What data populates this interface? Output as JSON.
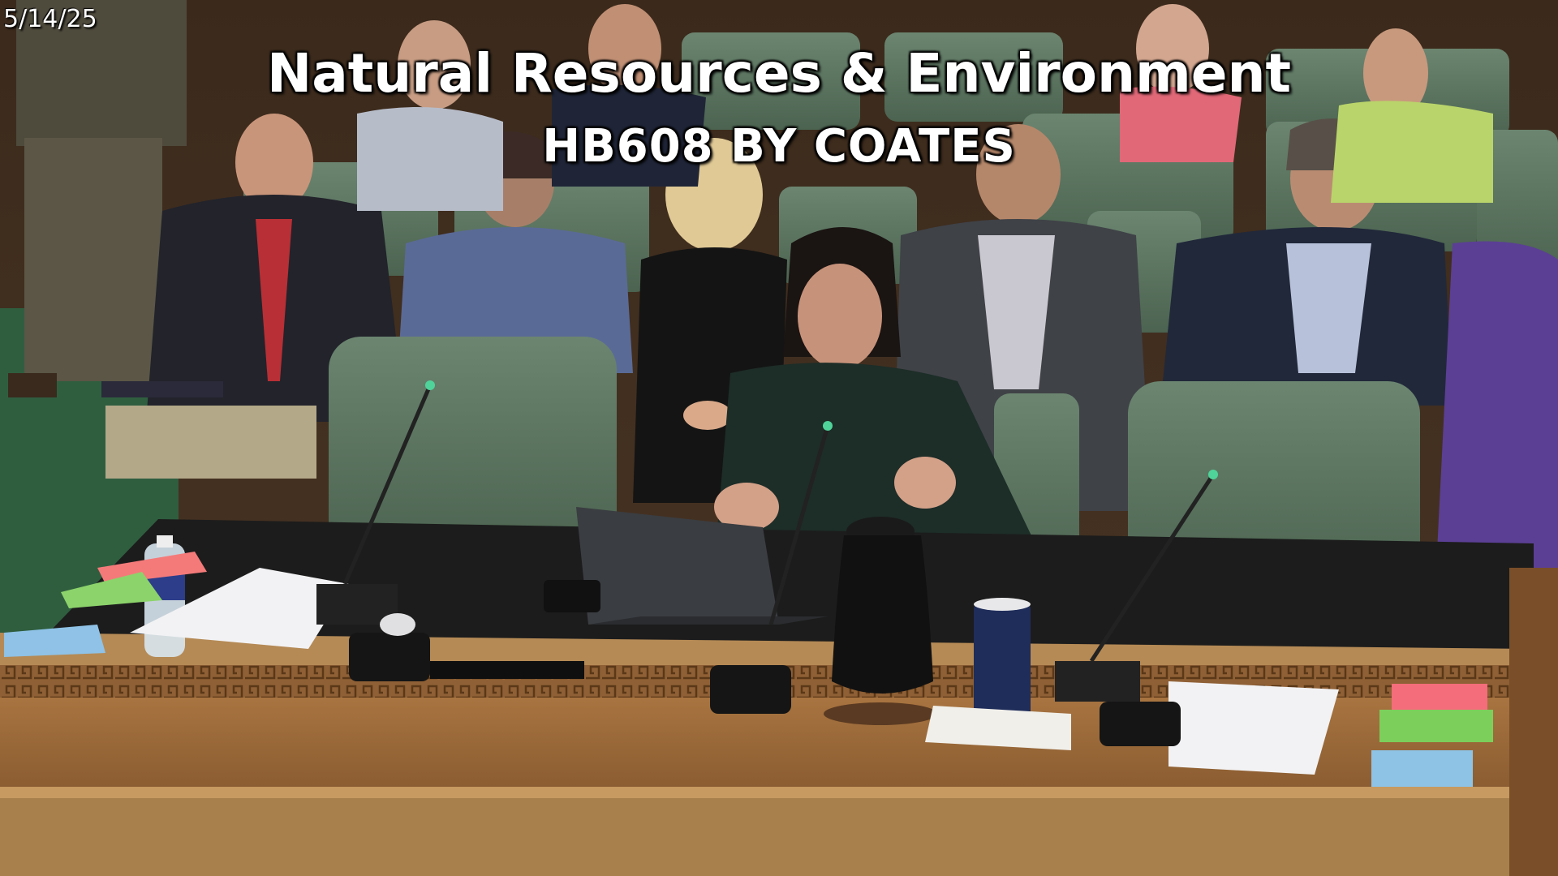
{
  "overlay": {
    "date": "5/14/25",
    "title": "Natural Resources & Environment",
    "subtitle": "HB608 BY COATES"
  },
  "colors": {
    "seat_green": "#5b7560",
    "wood": "#8a5a2e",
    "desk_top": "#1c1c1c",
    "floor": "#2f5e3f"
  }
}
